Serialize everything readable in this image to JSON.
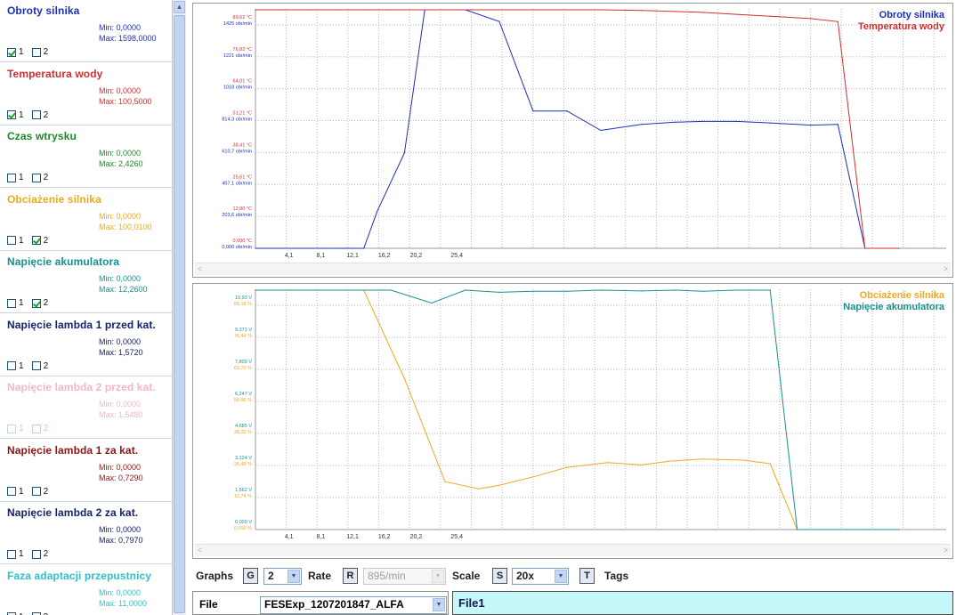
{
  "sidebar": {
    "params": [
      {
        "name": "Obroty silnika",
        "min": "Min: 0,0000",
        "max": "Max: 1598,0000",
        "color": "#1e2fb5",
        "cb1": true,
        "cb2": false,
        "faded": false
      },
      {
        "name": "Temperatura wody",
        "min": "Min: 0,0000",
        "max": "Max: 100,5000",
        "color": "#d42d2d",
        "cb1": true,
        "cb2": false,
        "faded": false
      },
      {
        "name": "Czas wtrysku",
        "min": "Min: 0,0000",
        "max": "Max: 2,4260",
        "color": "#1d8a25",
        "cb1": false,
        "cb2": false,
        "faded": false
      },
      {
        "name": "Obciażenie silnika",
        "min": "Min: 0,0000",
        "max": "Max: 100,0100",
        "color": "#f0a81e",
        "cb1": false,
        "cb2": true,
        "faded": false
      },
      {
        "name": "Napięcie akumulatora",
        "min": "Min: 0,0000",
        "max": "Max: 12,2600",
        "color": "#18908f",
        "cb1": false,
        "cb2": true,
        "faded": false
      },
      {
        "name": "Napięcie lambda 1 przed kat.",
        "min": "Min: 0,0000",
        "max": "Max: 1,5720",
        "color": "#13236e",
        "cb1": false,
        "cb2": false,
        "faded": false
      },
      {
        "name": "Napięcie lambda 2 przed kat.",
        "min": "Min: 0,0000",
        "max": "Max: 1,5480",
        "color": "#f2b6c6",
        "cb1": false,
        "cb2": false,
        "faded": true
      },
      {
        "name": "Napięcie lambda 1 za kat.",
        "min": "Min: 0,0000",
        "max": "Max: 0,7290",
        "color": "#8e1616",
        "cb1": false,
        "cb2": false,
        "faded": false
      },
      {
        "name": "Napięcie lambda 2 za kat.",
        "min": "Min: 0,0000",
        "max": "Max: 0,7970",
        "color": "#13236e",
        "cb1": false,
        "cb2": false,
        "faded": false
      },
      {
        "name": "Faza adaptacji przepustnicy",
        "min": "Min: 0,0000",
        "max": "Max: 11,0000",
        "color": "#2ec2c9",
        "cb1": false,
        "cb2": false,
        "faded": false
      }
    ],
    "cb1_label": "1",
    "cb2_label": "2"
  },
  "chart_data": [
    {
      "type": "line",
      "x_ticks": [
        "4,1",
        "8,1",
        "12,1",
        "16,2",
        "20,2",
        "25,4"
      ],
      "x_range": [
        0,
        102
      ],
      "xlabel": "",
      "ylabel": "",
      "grid": true,
      "legend_position": "top-right",
      "y_left_labels": [
        {
          "lines": [
            "0,000 °C",
            "0,000 obr/min"
          ]
        },
        {
          "lines": [
            "12,80 °C",
            "203,6 obr/min"
          ]
        },
        {
          "lines": [
            "25,61 °C",
            "407,1 obr/min"
          ]
        },
        {
          "lines": [
            "38,41 °C",
            "610,7 obr/min"
          ]
        },
        {
          "lines": [
            "51,21 °C",
            "814,3 obr/min"
          ]
        },
        {
          "lines": [
            "64,01 °C",
            "1018 obr/min"
          ]
        },
        {
          "lines": [
            "76,82 °C",
            "1221 obr/min"
          ]
        },
        {
          "lines": [
            "89,62 °C",
            "1425 obr/min"
          ]
        }
      ],
      "label_colors": [
        "#d42d2d",
        "#1e2fb5"
      ],
      "series": [
        {
          "name": "Obroty silnika",
          "color": "#1e2fb5",
          "y_range": [
            0,
            1598
          ],
          "x": [
            0,
            4,
            8,
            12,
            13,
            16,
            18,
            22,
            25,
            31,
            36,
            41,
            46,
            51,
            57,
            62,
            66,
            71,
            76,
            82,
            86,
            90,
            95
          ],
          "values": [
            0,
            0,
            0,
            0,
            0,
            0,
            250,
            640,
            1598,
            1598,
            1520,
            920,
            920,
            790,
            830,
            845,
            850,
            850,
            840,
            825,
            830,
            0,
            0
          ]
        },
        {
          "name": "Temperatura wody",
          "color": "#d42d2d",
          "y_range": [
            0,
            100.5
          ],
          "x": [
            0,
            4,
            8,
            12,
            16,
            20,
            25,
            30,
            36,
            41,
            46,
            51,
            57,
            62,
            66,
            71,
            76,
            82,
            86,
            90,
            95
          ],
          "values": [
            100.5,
            100.5,
            100.5,
            100.5,
            100.5,
            100.5,
            100.5,
            100.5,
            100.5,
            100.5,
            100.5,
            100.5,
            100.2,
            99.8,
            99.4,
            98.6,
            97.8,
            96.8,
            95.5,
            0,
            0
          ]
        }
      ]
    },
    {
      "type": "line",
      "x_ticks": [
        "4,1",
        "8,1",
        "12,1",
        "16,2",
        "20,2",
        "25,4"
      ],
      "x_range": [
        0,
        102
      ],
      "xlabel": "",
      "ylabel": "",
      "grid": true,
      "legend_position": "top-right",
      "y_left_labels": [
        {
          "lines": [
            "0,000 V",
            "0,000 %"
          ]
        },
        {
          "lines": [
            "1,562 V",
            "12,74 %"
          ]
        },
        {
          "lines": [
            "3,124 V",
            "25,48 %"
          ]
        },
        {
          "lines": [
            "4,685 V",
            "38,22 %"
          ]
        },
        {
          "lines": [
            "6,247 V",
            "50,96 %"
          ]
        },
        {
          "lines": [
            "7,809 V",
            "63,70 %"
          ]
        },
        {
          "lines": [
            "9,371 V",
            "76,44 %"
          ]
        },
        {
          "lines": [
            "10,93 V",
            "89,18 %"
          ]
        }
      ],
      "label_colors": [
        "#18908f",
        "#f0a81e"
      ],
      "series": [
        {
          "name": "Obciażenie silnika",
          "color": "#f0a81e",
          "y_range": [
            0,
            100.01
          ],
          "x": [
            0,
            6,
            10,
            16,
            22,
            28,
            33,
            36,
            41,
            46,
            52,
            57,
            61,
            66,
            72,
            76,
            80,
            85,
            90,
            95
          ],
          "values": [
            100.01,
            100.01,
            100.01,
            100.01,
            63,
            20,
            17,
            18.5,
            22,
            26,
            28,
            27,
            28.5,
            29.5,
            29,
            27.5,
            0,
            0,
            0,
            0
          ]
        },
        {
          "name": "Napięcie akumulatora",
          "color": "#18908f",
          "y_range": [
            0,
            12.26
          ],
          "x": [
            0,
            4,
            8,
            12,
            16,
            20,
            26,
            31,
            36,
            41,
            46,
            51,
            57,
            62,
            66,
            71,
            76,
            80,
            84,
            90,
            95
          ],
          "values": [
            12.26,
            12.26,
            12.26,
            12.26,
            12.26,
            12.26,
            11.6,
            12.26,
            12.15,
            12.2,
            12.2,
            12.26,
            12.22,
            12.26,
            12.2,
            12.26,
            12.26,
            0,
            0,
            0,
            0
          ]
        }
      ]
    }
  ],
  "toolbar": {
    "graphs_label": "Graphs",
    "graphs_key": "G",
    "graphs_value": "2",
    "rate_label": "Rate",
    "rate_key": "R",
    "rate_value": "895/min",
    "scale_label": "Scale",
    "scale_key": "S",
    "scale_value": "20x",
    "tags_key": "T",
    "tags_label": "Tags"
  },
  "file": {
    "label": "File",
    "selected": "FESExp_1207201847_ALFA",
    "panel_title": "File1"
  },
  "icons": {
    "scroll_up": "arrow-up-icon",
    "dropdown": "chevron-down-icon",
    "scroll_left": "chevron-left-icon",
    "scroll_right": "chevron-right-icon",
    "checkmark": "check-icon"
  }
}
